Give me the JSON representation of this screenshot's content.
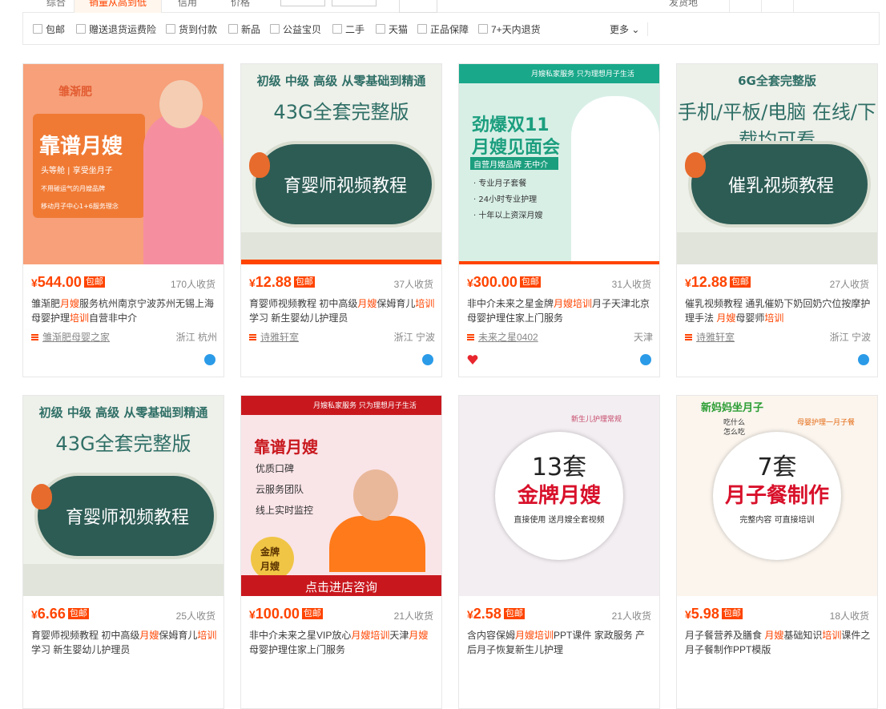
{
  "sort": {
    "tabs": [
      "综合",
      "销量从高到低",
      "信用",
      "价格"
    ],
    "view_right_label": "发货地"
  },
  "filters": {
    "items": [
      "包邮",
      "赠送退货运费险",
      "货到付款",
      "新品",
      "公益宝贝",
      "二手",
      "天猫",
      "正品保障",
      "7+天内退货"
    ],
    "more": "更多"
  },
  "products": [
    {
      "price": "544.00",
      "sales": "170人收货",
      "title_parts": [
        [
          "雏渐肥",
          ""
        ],
        [
          "月嫂",
          "hl"
        ],
        [
          "服务杭州南京宁波苏州无锡上海母婴护理",
          ""
        ],
        [
          "培训",
          "hl"
        ],
        [
          "自营非中介",
          ""
        ]
      ],
      "shop": "雏渐肥母婴之家",
      "location": "浙江 杭州",
      "img": {
        "bg": "#f7a07a",
        "lines": [
          "雏渐肥",
          "靠谱月嫂",
          "头等舱 | 享受坐月子",
          "不用碰运气的月嫂品牌",
          "移动月子中心1+6服务理念"
        ]
      }
    },
    {
      "price": "12.88",
      "sales": "37人收货",
      "title_parts": [
        [
          "育婴师视频教程 初中高级",
          ""
        ],
        [
          "月嫂",
          "hl"
        ],
        [
          "保姆育儿",
          ""
        ],
        [
          "培训",
          "hl"
        ],
        [
          "学习 新生婴幼儿护理员",
          ""
        ]
      ],
      "shop": "诗雅轩室",
      "location": "浙江 宁波",
      "img": {
        "bg": "#e9ece3",
        "lines": [
          "初级 中级 高级 从零基础到精通",
          "43G全套完整版",
          "育婴师视频教程"
        ]
      }
    },
    {
      "price": "300.00",
      "sales": "31人收货",
      "title_parts": [
        [
          "非中介未来之星金牌",
          ""
        ],
        [
          "月嫂培训",
          "hl"
        ],
        [
          "月子天津北京母婴护理住家上门服务",
          ""
        ]
      ],
      "shop": "未来之星0402",
      "location": "天津",
      "img": {
        "bg": "#d8efe6",
        "lines": [
          "月嫂私家服务",
          "只为理想月子生活",
          "劲爆双11",
          "月嫂见面会",
          "自营月嫂品牌 无中介",
          "专业月子套餐",
          "24小时专业护理",
          "十年以上资深月嫂"
        ]
      }
    },
    {
      "price": "12.88",
      "sales": "27人收货",
      "title_parts": [
        [
          "催乳视频教程 通乳催奶下奶回奶穴位按摩护理手法 ",
          ""
        ],
        [
          "月嫂",
          "hl"
        ],
        [
          "母婴师",
          ""
        ],
        [
          "培训",
          "hl"
        ]
      ],
      "shop": "诗雅轩室",
      "location": "浙江 宁波",
      "img": {
        "bg": "#e9ece3",
        "lines": [
          "6G全套完整版",
          "手机/平板/电脑 在线/下载均可看",
          "催乳视频教程"
        ]
      }
    },
    {
      "price": "6.66",
      "sales": "25人收货",
      "title_parts": [
        [
          "育婴师视频教程 初中高级",
          ""
        ],
        [
          "月嫂",
          "hl"
        ],
        [
          "保姆育儿",
          ""
        ],
        [
          "培训",
          "hl"
        ],
        [
          "学习 新生婴幼儿护理员",
          ""
        ]
      ],
      "shop": "",
      "location": "",
      "img": {
        "bg": "#e9ece3",
        "lines": [
          "初级 中级 高级 从零基础到精通",
          "43G全套完整版",
          "育婴师视频教程"
        ]
      }
    },
    {
      "price": "100.00",
      "sales": "21人收货",
      "title_parts": [
        [
          "非中介未来之星VIP放心",
          ""
        ],
        [
          "月嫂培训",
          "hl"
        ],
        [
          "天津",
          ""
        ],
        [
          "月嫂",
          "hl"
        ],
        [
          "母婴护理住家上门服务",
          ""
        ]
      ],
      "shop": "",
      "location": "",
      "img": {
        "bg": "#f9e4e8",
        "lines": [
          "月嫂私家服务",
          "只为理想月子生活",
          "靠谱月嫂",
          "优质口碑",
          "云服务团队",
          "线上实时监控",
          "金牌",
          "月嫂",
          "点击进店咨询"
        ]
      }
    },
    {
      "price": "2.58",
      "sales": "21人收货",
      "title_parts": [
        [
          "含内容保姆",
          ""
        ],
        [
          "月嫂培训",
          "hl"
        ],
        [
          "PPT课件 家政服务 产后月子恢复新生儿护理",
          ""
        ]
      ],
      "shop": "",
      "location": "",
      "img": {
        "bg": "#f3eef2",
        "lines": [
          "新生儿护理常规",
          "13套",
          "金牌月嫂",
          "直接使用 送月嫂全套视频"
        ]
      }
    },
    {
      "price": "5.98",
      "sales": "18人收货",
      "title_parts": [
        [
          "月子餐营养及膳食 ",
          ""
        ],
        [
          "月嫂",
          "hl"
        ],
        [
          "基础知识",
          ""
        ],
        [
          "培训",
          "hl"
        ],
        [
          "课件之月子餐制作PPT模版",
          ""
        ]
      ],
      "shop": "",
      "location": "",
      "img": {
        "bg": "#fbf5ee",
        "lines": [
          "新妈妈坐月子",
          "吃什么",
          "怎么吃",
          "母婴护理一月子餐",
          "7套",
          "月子餐制作",
          "完整内容 可直接培训"
        ]
      }
    }
  ],
  "labels": {
    "yen": "¥",
    "baoyou": "包邮"
  },
  "colors": {
    "accent": "#ff4400",
    "teal": "#2f6f66"
  }
}
